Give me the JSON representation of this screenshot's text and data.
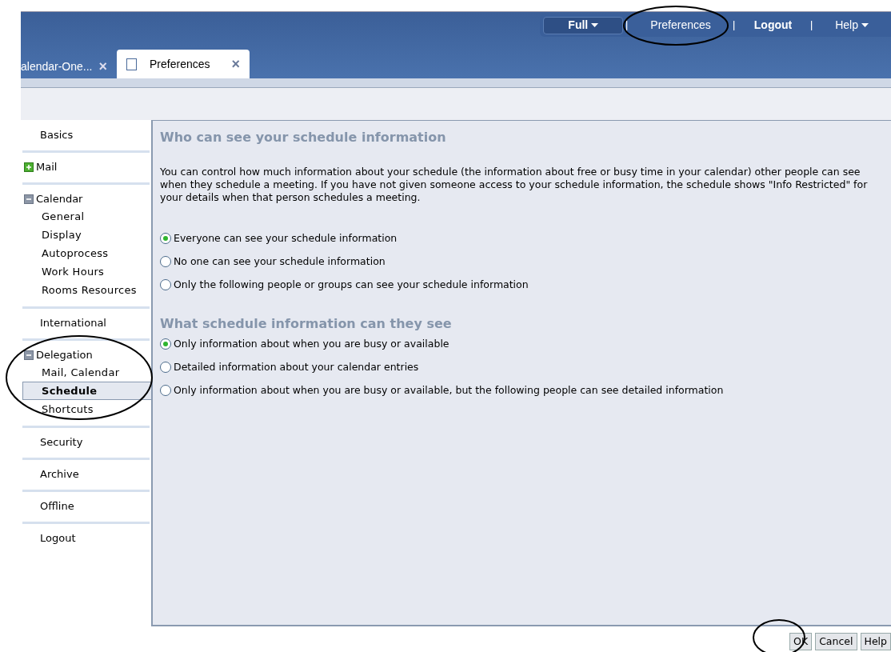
{
  "top_menu": [
    {
      "label": "Full",
      "dropdown": true,
      "kind": "pill"
    },
    {
      "label": "Preferences",
      "dropdown": false,
      "kind": "link"
    },
    {
      "label": "Logout",
      "dropdown": false,
      "kind": "bold"
    },
    {
      "label": "Help",
      "dropdown": true,
      "kind": "link"
    }
  ],
  "tabs": [
    {
      "label": "alendar-One...",
      "selected": false,
      "close": "×",
      "icon": false
    },
    {
      "label": "Preferences",
      "selected": true,
      "close": "×",
      "icon": true
    }
  ],
  "sidebar": {
    "sections": [
      {
        "label": "Basics",
        "selected": false
      },
      {
        "label": "Mail",
        "expanded": false,
        "selected": false
      },
      {
        "label": "Calendar",
        "expanded": true,
        "selected": false,
        "children": [
          {
            "label": "General",
            "selected": false
          },
          {
            "label": "Display",
            "selected": false
          },
          {
            "label": "Autoprocess",
            "selected": false
          },
          {
            "label": "Work Hours",
            "selected": false
          },
          {
            "label": "Rooms Resources",
            "selected": false
          }
        ]
      },
      {
        "label": "International",
        "selected": false
      },
      {
        "label": "Delegation",
        "expanded": true,
        "selected": false,
        "children": [
          {
            "label": "Mail, Calendar",
            "selected": false
          },
          {
            "label": "Schedule",
            "selected": true
          },
          {
            "label": "Shortcuts",
            "selected": false
          }
        ]
      },
      {
        "label": "Security",
        "selected": false
      },
      {
        "label": "Archive",
        "selected": false
      },
      {
        "label": "Offline",
        "selected": false
      },
      {
        "label": "Logout",
        "selected": false
      }
    ]
  },
  "content": {
    "heading": "Who can see your schedule information",
    "description": "You can control how much information about your schedule (the information about free or busy time in your calendar) other people can see when they schedule a meeting. If you have not given someone access to your schedule information, the schedule shows \"Info Restricted\" for your details when that person schedules a meeting.",
    "who_options": [
      {
        "label": "Everyone can see your schedule information",
        "selected": true
      },
      {
        "label": "No one can see your schedule information",
        "selected": false
      },
      {
        "label": "Only the following people or groups can see your schedule information",
        "selected": false
      }
    ],
    "subheading": "What schedule information can they see",
    "what_options": [
      {
        "label": "Only information about when you are busy or available",
        "selected": true
      },
      {
        "label": "Detailed information about your calendar entries",
        "selected": false
      },
      {
        "label": "Only information about when you are busy or available, but the following people can see detailed information",
        "selected": false
      }
    ]
  },
  "buttons": [
    "OK",
    "Cancel",
    "Help"
  ]
}
